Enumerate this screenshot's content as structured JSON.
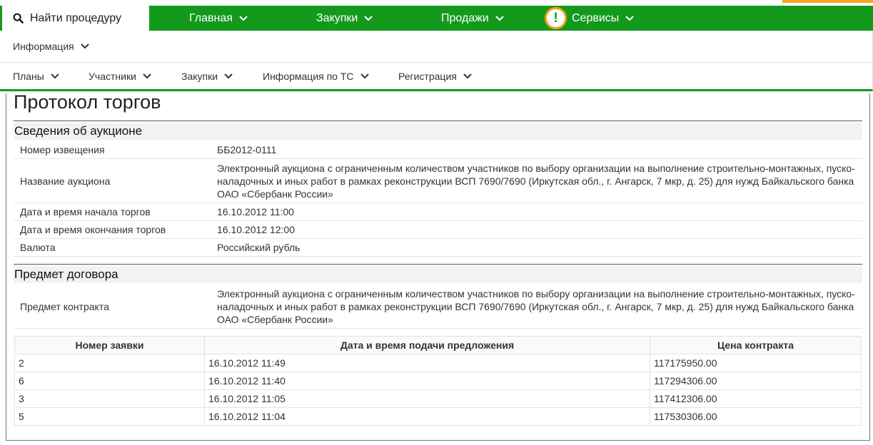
{
  "colors": {
    "brand_green": "#139a1c",
    "accent_orange": "#f7a21b"
  },
  "top_nav": {
    "search_label": "Найти процедуру",
    "items": [
      {
        "label": "Главная"
      },
      {
        "label": "Закупки"
      },
      {
        "label": "Продажи"
      },
      {
        "label": "Сервисы"
      }
    ],
    "alert_glyph": "!"
  },
  "info_nav": {
    "label": "Информация"
  },
  "sub_nav": {
    "items": [
      {
        "label": "Планы"
      },
      {
        "label": "Участники"
      },
      {
        "label": "Закупки"
      },
      {
        "label": "Информация по ТС"
      },
      {
        "label": "Регистрация"
      }
    ]
  },
  "page": {
    "title": "Протокол торгов",
    "auction_section": {
      "heading": "Сведения об аукционе",
      "rows": [
        {
          "label": "Номер извещения",
          "value": "ББ2012-0111"
        },
        {
          "label": "Название аукциона",
          "value": "Электронный аукциона с ограниченным количеством участников по выбору организации на выполнение строительно-монтажных, пуско-наладочных и иных работ в рамках реконструкции ВСП 7690/7690 (Иркутская обл., г. Ангарск, 7 мкр, д. 25) для нужд Байкальского банка ОАО «Сбербанк России»"
        },
        {
          "label": "Дата и время начала торгов",
          "value": "16.10.2012 11:00"
        },
        {
          "label": "Дата и время окончания торгов",
          "value": "16.10.2012 12:00"
        },
        {
          "label": "Валюта",
          "value": "Российский рубль"
        }
      ]
    },
    "contract_section": {
      "heading": "Предмет договора",
      "rows": [
        {
          "label": "Предмет контракта",
          "value": "Электронный аукциона с ограниченным количеством участников по выбору организации на выполнение строительно-монтажных, пуско-наладочных и иных работ в рамках реконструкции ВСП 7690/7690 (Иркутская обл., г. Ангарск, 7 мкр, д. 25) для нужд Байкальского банка ОАО «Сбербанк России»"
        }
      ]
    },
    "bids_table": {
      "columns": [
        "Номер заявки",
        "Дата и время подачи предложения",
        "Цена контракта"
      ],
      "rows": [
        [
          "2",
          "16.10.2012 11:49",
          "117175950.00"
        ],
        [
          "6",
          "16.10.2012 11:40",
          "117294306.00"
        ],
        [
          "3",
          "16.10.2012 11:05",
          "117412306.00"
        ],
        [
          "5",
          "16.10.2012 11:04",
          "117530306.00"
        ]
      ]
    }
  }
}
